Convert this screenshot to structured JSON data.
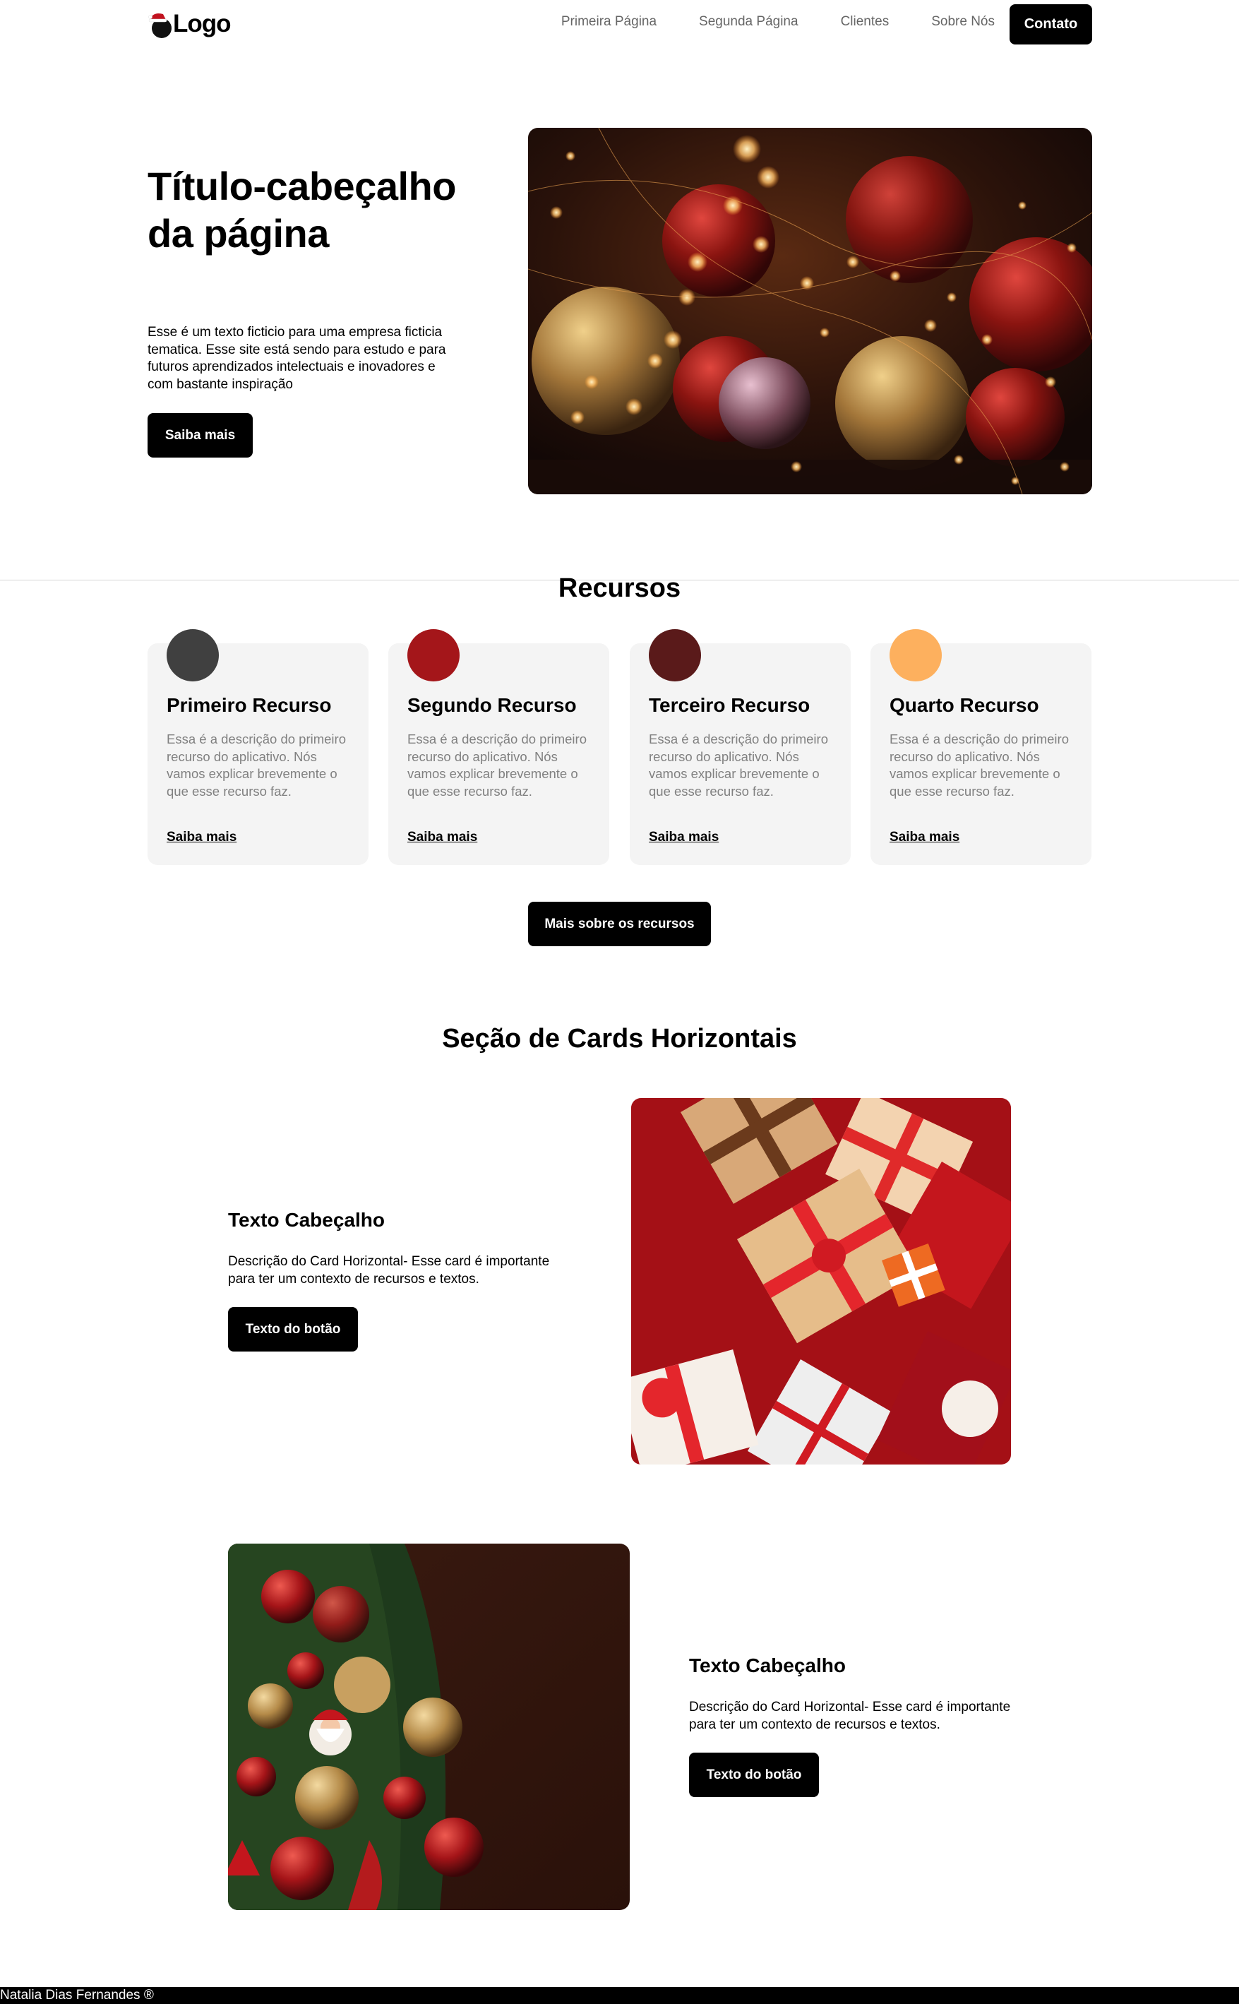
{
  "nav": {
    "logo_text": "Logo",
    "links": [
      "Primeira Página",
      "Segunda Página",
      "Clientes",
      "Sobre Nós"
    ],
    "cta": "Contato"
  },
  "hero": {
    "title": "Título-cabeçalho da página",
    "text": "Esse é um texto ficticio para uma empresa ficticia tematica. Esse site está sendo para estudo e para futuros aprendizados intelectuais e inovadores e com bastante inspiração",
    "button": "Saiba mais"
  },
  "recursos": {
    "title": "Recursos",
    "items": [
      {
        "title": "Primeiro Recurso",
        "desc": "Essa é a descrição do primeiro recurso do aplicativo. Nós vamos explicar brevemente o que esse recurso faz.",
        "link": "Saiba mais",
        "color": "#404040"
      },
      {
        "title": "Segundo Recurso",
        "desc": "Essa é a descrição do primeiro recurso do aplicativo. Nós vamos explicar brevemente o que esse recurso faz.",
        "link": "Saiba mais",
        "color": "#a4161a"
      },
      {
        "title": "Terceiro Recurso",
        "desc": "Essa é a descrição do primeiro recurso do aplicativo. Nós vamos explicar brevemente o que esse recurso faz.",
        "link": "Saiba mais",
        "color": "#5a1a1a"
      },
      {
        "title": "Quarto Recurso",
        "desc": "Essa é a descrição do primeiro recurso do aplicativo. Nós vamos explicar brevemente o que esse recurso faz.",
        "link": "Saiba mais",
        "color": "#fdb05e"
      }
    ],
    "button": "Mais sobre os recursos"
  },
  "hcards": {
    "title": "Seção de Cards Horizontais",
    "items": [
      {
        "title": "Texto Cabeçalho",
        "desc": "Descrição do Card Horizontal- Esse card é importante para ter um contexto de recursos e textos.",
        "button": "Texto do botão"
      },
      {
        "title": "Texto Cabeçalho",
        "desc": "Descrição do Card Horizontal- Esse card é importante para ter um contexto de recursos e textos.",
        "button": "Texto do botão"
      }
    ]
  },
  "footer": {
    "text": "Natalia Dias Fernandes ®"
  }
}
